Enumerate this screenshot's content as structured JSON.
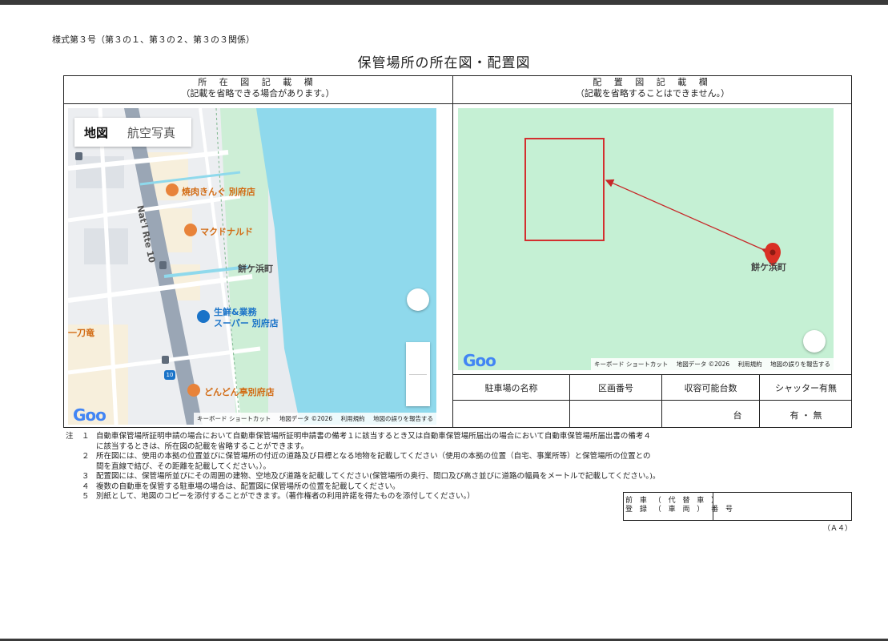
{
  "form_number": "様式第３号（第３の１、第３の２、第３の３関係）",
  "title": "保管場所の所在図・配置図",
  "left_section": {
    "heading": "所 在 図 記 載 欄",
    "note": "（記載を省略できる場合があります。）"
  },
  "right_section": {
    "heading": "配 置 図 記 載 欄",
    "note": "（記載を省略することはできません。）"
  },
  "left_map": {
    "tab_map": "地図",
    "tab_aerial": "航空写真",
    "pois": {
      "yakiniku": "焼肉きんぐ 別府店",
      "mcdonalds": "マクドナルド",
      "supermarket_line1": "生鮮&業務",
      "supermarket_line2": "スーパー 別府店",
      "dondon": "どんどん亭別府店"
    },
    "place_label": "餅ケ浜町",
    "road_label": "Nat'l Rte 10",
    "route_badge": "10",
    "edge_label": "一刀竜",
    "google_logo": "Goo",
    "attribution": {
      "shortcuts": "キーボード ショートカット",
      "map_data": "地図データ ©2026",
      "terms": "利用規約",
      "report": "地図の誤りを報告する"
    }
  },
  "right_map": {
    "place_label": "餅ケ浜町",
    "google_logo": "Goo",
    "attribution": {
      "shortcuts": "キーボード ショートカット",
      "map_data": "地図データ ©2026",
      "terms": "利用規約",
      "report": "地図の誤りを報告する"
    }
  },
  "parking_table": {
    "headers": [
      "駐車場の名称",
      "区画番号",
      "収容可能台数",
      "シャッター有無"
    ],
    "unit": "台",
    "shutter_value": "有 ・ 無"
  },
  "notes": {
    "label": "注",
    "items": [
      {
        "num": "１",
        "line1": "自動車保管場所証明申請の場合において自動車保管場所証明申請書の備考１に該当するとき又は自動車保管場所届出の場合において自動車保管場所届出書の備考４",
        "line2": "に該当するときは、所在図の記載を省略することができます。"
      },
      {
        "num": "２",
        "line1": "所在図には、使用の本拠の位置並びに保管場所の付近の道路及び目標となる地物を記載してください（使用の本拠の位置（自宅、事業所等）と保管場所の位置との",
        "line2": "間を直線で結び、その距離を記載してください。）。"
      },
      {
        "num": "３",
        "line1": "配置図には、保管場所並びにその周囲の建物、空地及び道路を記載してください(保管場所の奥行、間口及び高さ並びに道路の幅員をメートルで記載してください。)。",
        "line2": ""
      },
      {
        "num": "４",
        "line1": "複数の自動車を保管する駐車場の場合は、配置図に保管場所の位置を記載してください。",
        "line2": ""
      },
      {
        "num": "５",
        "line1": "別紙として、地図のコピーを添付することができます。（著作権者の利用許諾を得たものを添付してください。）",
        "line2": ""
      }
    ]
  },
  "previous_vehicle": {
    "label_line1": "前 車 （ 代 替 車 ）",
    "label_line2": "登 録 （ 車 両 ） 番 号",
    "value": ""
  },
  "paper_size": "（Ａ４）",
  "colors": {
    "water": "#8fd9ec",
    "park": "#c5f0d4",
    "marker": "#d93025",
    "box": "#d32f2f",
    "poi_orange": "#e8833a",
    "poi_blue": "#1a73c8"
  }
}
